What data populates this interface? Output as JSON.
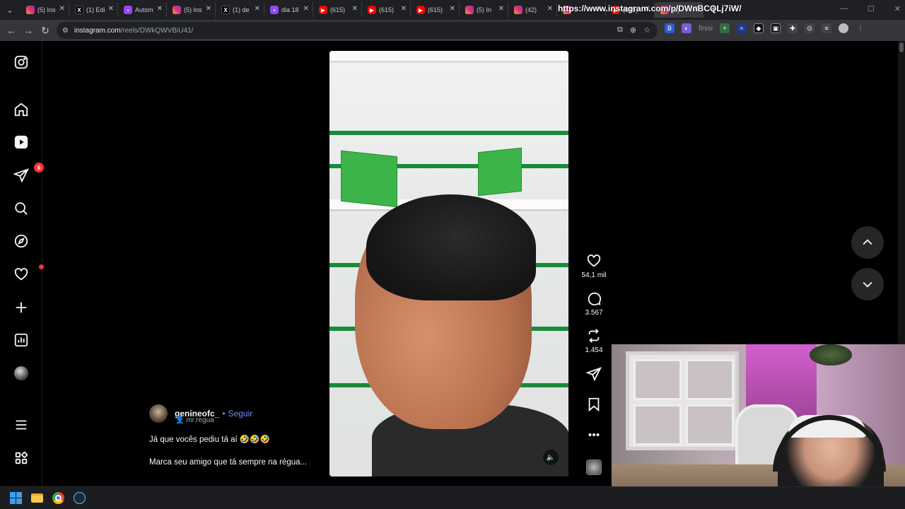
{
  "browser": {
    "tabs": [
      {
        "favicon": "instagram",
        "title": "(5) Ins"
      },
      {
        "favicon": "x",
        "title": "(1) Edi"
      },
      {
        "favicon": "twitch",
        "title": "Autsm"
      },
      {
        "favicon": "instagram",
        "title": "(5) Ins"
      },
      {
        "favicon": "x",
        "title": "(1) de"
      },
      {
        "favicon": "twitch",
        "title": "dia 18"
      },
      {
        "favicon": "youtube",
        "title": "(615)"
      },
      {
        "favicon": "youtube",
        "title": "(615)"
      },
      {
        "favicon": "youtube",
        "title": "(615)"
      },
      {
        "favicon": "instagram",
        "title": "(5) In"
      },
      {
        "favicon": "instagram",
        "title": "(42)"
      },
      {
        "favicon": "instagram",
        "title": ""
      },
      {
        "favicon": "youtube",
        "title": "(615)"
      },
      {
        "favicon": "instagram",
        "title": "(5)",
        "active": true
      }
    ],
    "hover_url": "https://www.instagram.com/p/DWnBCQLj7iW/",
    "address": {
      "host": "instagram.com",
      "path": "/reels/DWkQWVBiU41/"
    },
    "extension_label": "finisi"
  },
  "sidebar": {
    "items": [
      {
        "icon": "instagram-logo-icon"
      },
      {
        "icon": "home-icon"
      },
      {
        "icon": "reels-icon"
      },
      {
        "icon": "direct-messages-icon",
        "badge": "6"
      },
      {
        "icon": "search-icon"
      },
      {
        "icon": "explore-icon"
      },
      {
        "icon": "notifications-heart-icon",
        "dot": true
      },
      {
        "icon": "create-plus-icon"
      },
      {
        "icon": "dashboard-icon"
      },
      {
        "icon": "profile-avatar"
      },
      {
        "icon": "menu-icon"
      },
      {
        "icon": "also-from-meta-icon"
      }
    ]
  },
  "reel": {
    "author": "genineofc_",
    "follow_label": "Seguir",
    "separator": "•",
    "collaborator": "mr.regua",
    "caption_line1": "Já que vocês pediu tá aí 🤣🤣🤣",
    "caption_line2": "Marca seu amigo que tá sempre na régua...",
    "likes": "54,1 mil",
    "comments": "3.567",
    "reposts": "1.454"
  },
  "colors": {
    "follow_blue": "#708dff",
    "badge_red": "#ff3040",
    "shelf_green": "#1a8a3c"
  }
}
